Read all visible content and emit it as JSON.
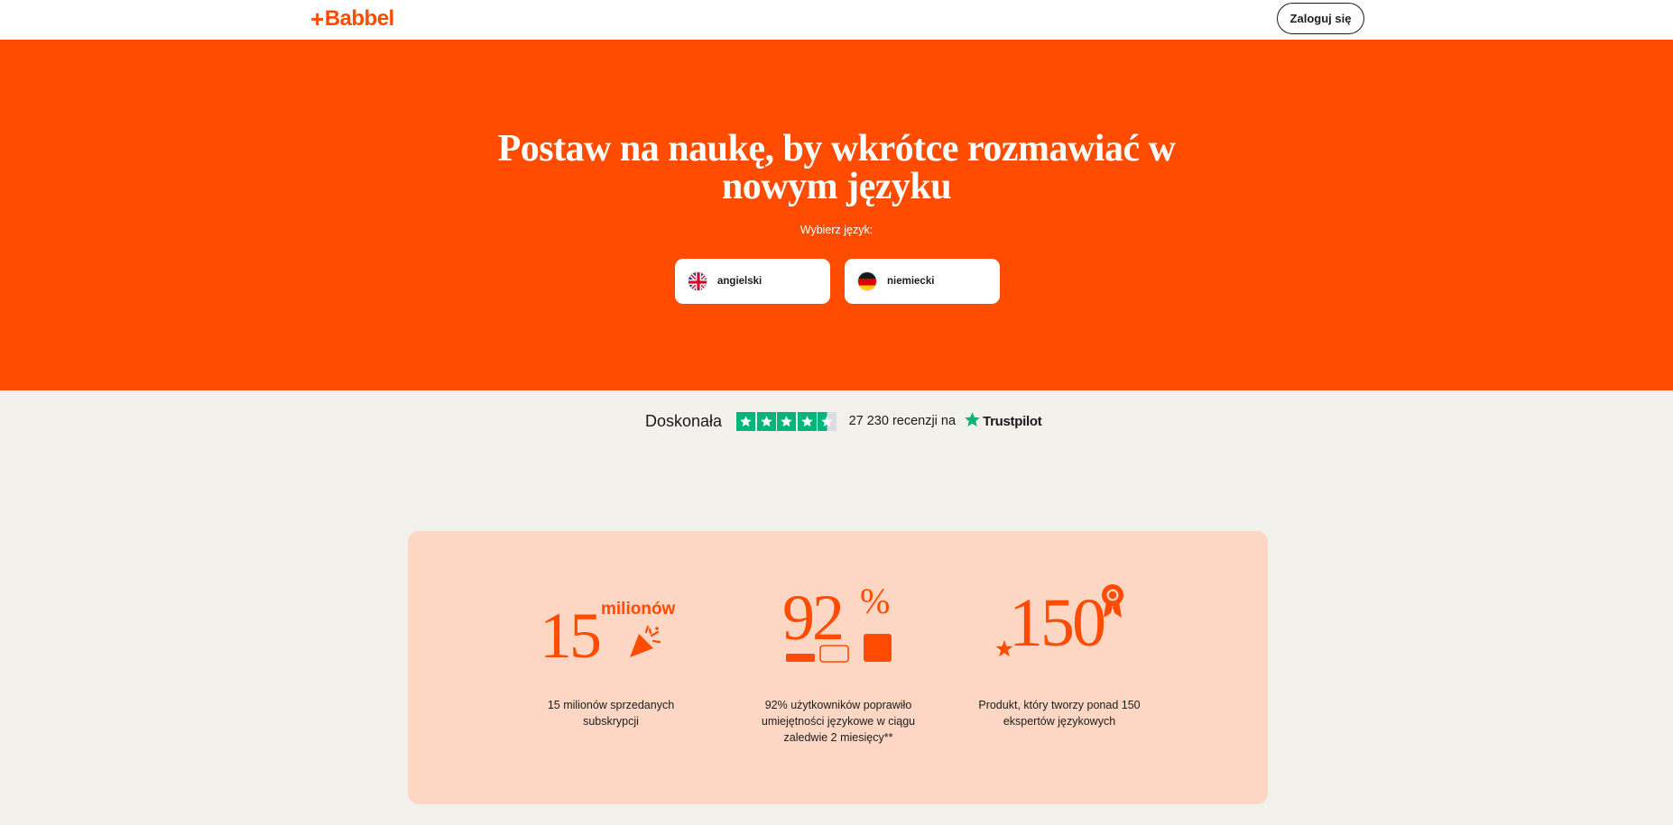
{
  "header": {
    "logo_text": "Babbel",
    "login_label": "Zaloguj się"
  },
  "hero": {
    "title": "Postaw na naukę, by wkrótce rozmawiać w nowym języku",
    "subtitle": "Wybierz język:",
    "languages": [
      {
        "label": "angielski",
        "flag": "uk-flag-icon"
      },
      {
        "label": "niemiecki",
        "flag": "germany-flag-icon"
      }
    ]
  },
  "trustpilot": {
    "rating_word": "Doskonała",
    "reviews_text": "27 230 recenzji na",
    "brand": "Trustpilot",
    "stars": 4.5
  },
  "stats": [
    {
      "figure": "15",
      "figure_word": "milionów",
      "text": "15 milionów sprzedanych subskrypcji",
      "icon": "party-popper-icon"
    },
    {
      "figure": "92",
      "figure_suffix": "%",
      "text": "92% użytkowników poprawiło umiejętności językowe w ciągu zaledwie 2 miesięcy**",
      "icon": "progress-blocks-icon"
    },
    {
      "figure": "150",
      "text": "Produkt, który tworzy ponad 150 ekspertów językowych",
      "icon": "award-badge-icon"
    }
  ],
  "colors": {
    "brand": "#ff4c00",
    "page_bg": "#f3f1ec",
    "stats_bg": "#fdd6c4",
    "trustpilot_green": "#00b67a"
  }
}
